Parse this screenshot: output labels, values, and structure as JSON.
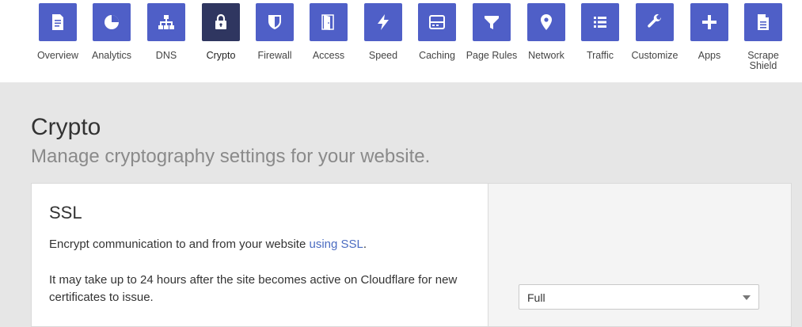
{
  "nav": {
    "items": [
      {
        "label": "Overview",
        "icon": "overview-document-icon",
        "active": false
      },
      {
        "label": "Analytics",
        "icon": "pie-chart-icon",
        "active": false
      },
      {
        "label": "DNS",
        "icon": "network-tree-icon",
        "active": false
      },
      {
        "label": "Crypto",
        "icon": "lock-icon",
        "active": true
      },
      {
        "label": "Firewall",
        "icon": "shield-icon",
        "active": false
      },
      {
        "label": "Access",
        "icon": "door-icon",
        "active": false
      },
      {
        "label": "Speed",
        "icon": "lightning-icon",
        "active": false
      },
      {
        "label": "Caching",
        "icon": "server-icon",
        "active": false
      },
      {
        "label": "Page Rules",
        "icon": "filter-icon",
        "active": false
      },
      {
        "label": "Network",
        "icon": "map-pin-icon",
        "active": false
      },
      {
        "label": "Traffic",
        "icon": "list-icon",
        "active": false
      },
      {
        "label": "Customize",
        "icon": "wrench-icon",
        "active": false
      },
      {
        "label": "Apps",
        "icon": "plus-icon",
        "active": false
      },
      {
        "label": "Scrape\nShield",
        "icon": "scrape-document-icon",
        "active": false
      }
    ],
    "tile_color": "#4f5fc7",
    "active_tile_color": "#2f3660"
  },
  "page": {
    "title": "Crypto",
    "subtitle": "Manage cryptography settings for your website."
  },
  "ssl_card": {
    "title": "SSL",
    "description_before_link": "Encrypt communication to and from your website ",
    "description_link": "using SSL",
    "description_after_link": ".",
    "note": "It may take up to 24 hours after the site becomes active on Cloudflare for new certificates to issue.",
    "select_value": "Full"
  },
  "colors": {
    "link": "#4b6cc1",
    "page_background": "#e6e6e6"
  }
}
